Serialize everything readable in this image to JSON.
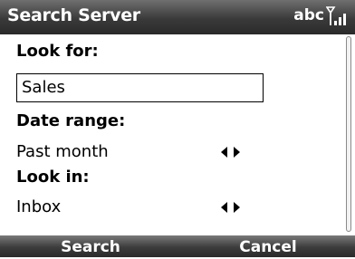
{
  "titlebar": {
    "title": "Search Server",
    "input_mode": "abc",
    "signal_icon": "signal-strength-icon"
  },
  "form": {
    "look_for_label": "Look for:",
    "look_for_value": "Sales",
    "date_range_label": "Date range:",
    "date_range_value": "Past month",
    "look_in_label": "Look in:",
    "look_in_value": "Inbox"
  },
  "softkeys": {
    "left": "Search",
    "right": "Cancel"
  }
}
